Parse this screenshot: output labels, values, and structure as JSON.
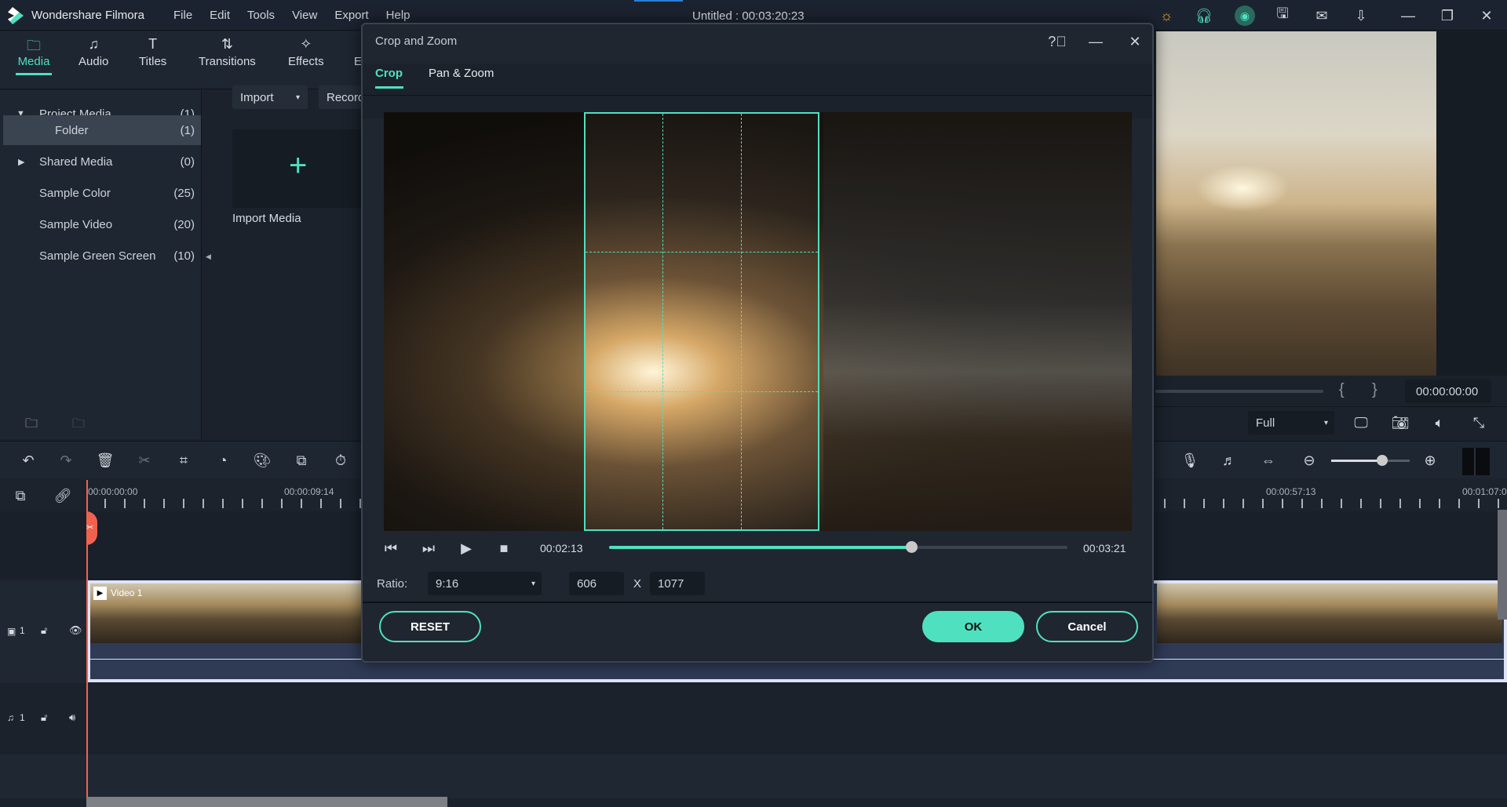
{
  "app": {
    "name": "Wondershare Filmora",
    "project_title": "Untitled : 00:03:20:23"
  },
  "menu": [
    "File",
    "Edit",
    "Tools",
    "View",
    "Export",
    "Help"
  ],
  "title_icons": [
    "bulb-icon",
    "headset-icon",
    "account-icon",
    "save-icon",
    "mail-icon",
    "download-icon"
  ],
  "tabs": [
    {
      "label": "Media",
      "active": true
    },
    {
      "label": "Audio"
    },
    {
      "label": "Titles"
    },
    {
      "label": "Transitions"
    },
    {
      "label": "Effects"
    },
    {
      "label": "E"
    }
  ],
  "sidebar": {
    "items": [
      {
        "label": "Project Media",
        "count": "(1)"
      },
      {
        "label": "Folder",
        "count": "(1)",
        "selected": true
      },
      {
        "label": "Shared Media",
        "count": "(0)"
      },
      {
        "label": "Sample Color",
        "count": "(25)"
      },
      {
        "label": "Sample Video",
        "count": "(20)"
      },
      {
        "label": "Sample Green Screen",
        "count": "(10)"
      }
    ]
  },
  "media": {
    "import_label": "Import",
    "record_label": "Record",
    "import_media_label": "Import Media"
  },
  "preview": {
    "timecode": "00:00:00:00",
    "quality": "Full",
    "bracket_in": "{",
    "bracket_out": "}"
  },
  "timeline": {
    "ruler": [
      "00:00:00:00",
      "00:00:09:14",
      "00:00:57:13",
      "00:01:07:0"
    ],
    "video_track": "1",
    "audio_track": "1",
    "clip_label": "Video 1",
    "zoom_level": 0.65
  },
  "dialog": {
    "title": "Crop and Zoom",
    "tabs": [
      {
        "label": "Crop",
        "active": true
      },
      {
        "label": "Pan & Zoom"
      }
    ],
    "current_time": "00:02:13",
    "total_time": "00:03:21",
    "progress": 0.66,
    "ratio_label": "Ratio:",
    "ratio_value": "9:16",
    "width": "606",
    "x_label": "X",
    "height": "1077",
    "reset_label": "RESET",
    "ok_label": "OK",
    "cancel_label": "Cancel"
  },
  "colors": {
    "accent": "#4fe0c0",
    "playhead": "#f0624d"
  }
}
